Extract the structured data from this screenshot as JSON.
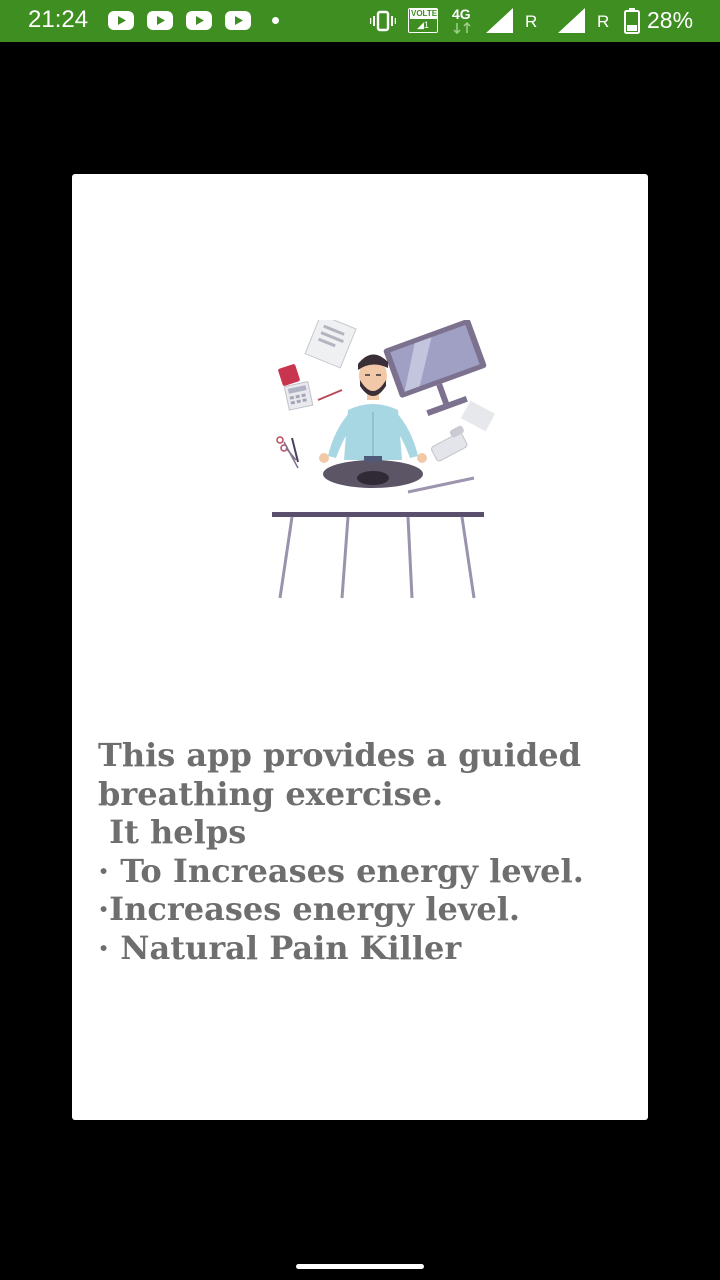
{
  "status_bar": {
    "time": "21:24",
    "network_type": "4G",
    "volte_label": "VOLTE",
    "sim1_roaming": "R",
    "sim2_roaming": "R",
    "battery_percent": "28%",
    "color": "#3f8e22"
  },
  "dialog": {
    "illustration": "meditating-man-at-desk-illustration",
    "description_lines": [
      "This app provides a guided",
      "breathing exercise.",
      " It helps",
      "· To Increases energy level.",
      "·Increases energy level.",
      "· Natural Pain Killer"
    ]
  }
}
